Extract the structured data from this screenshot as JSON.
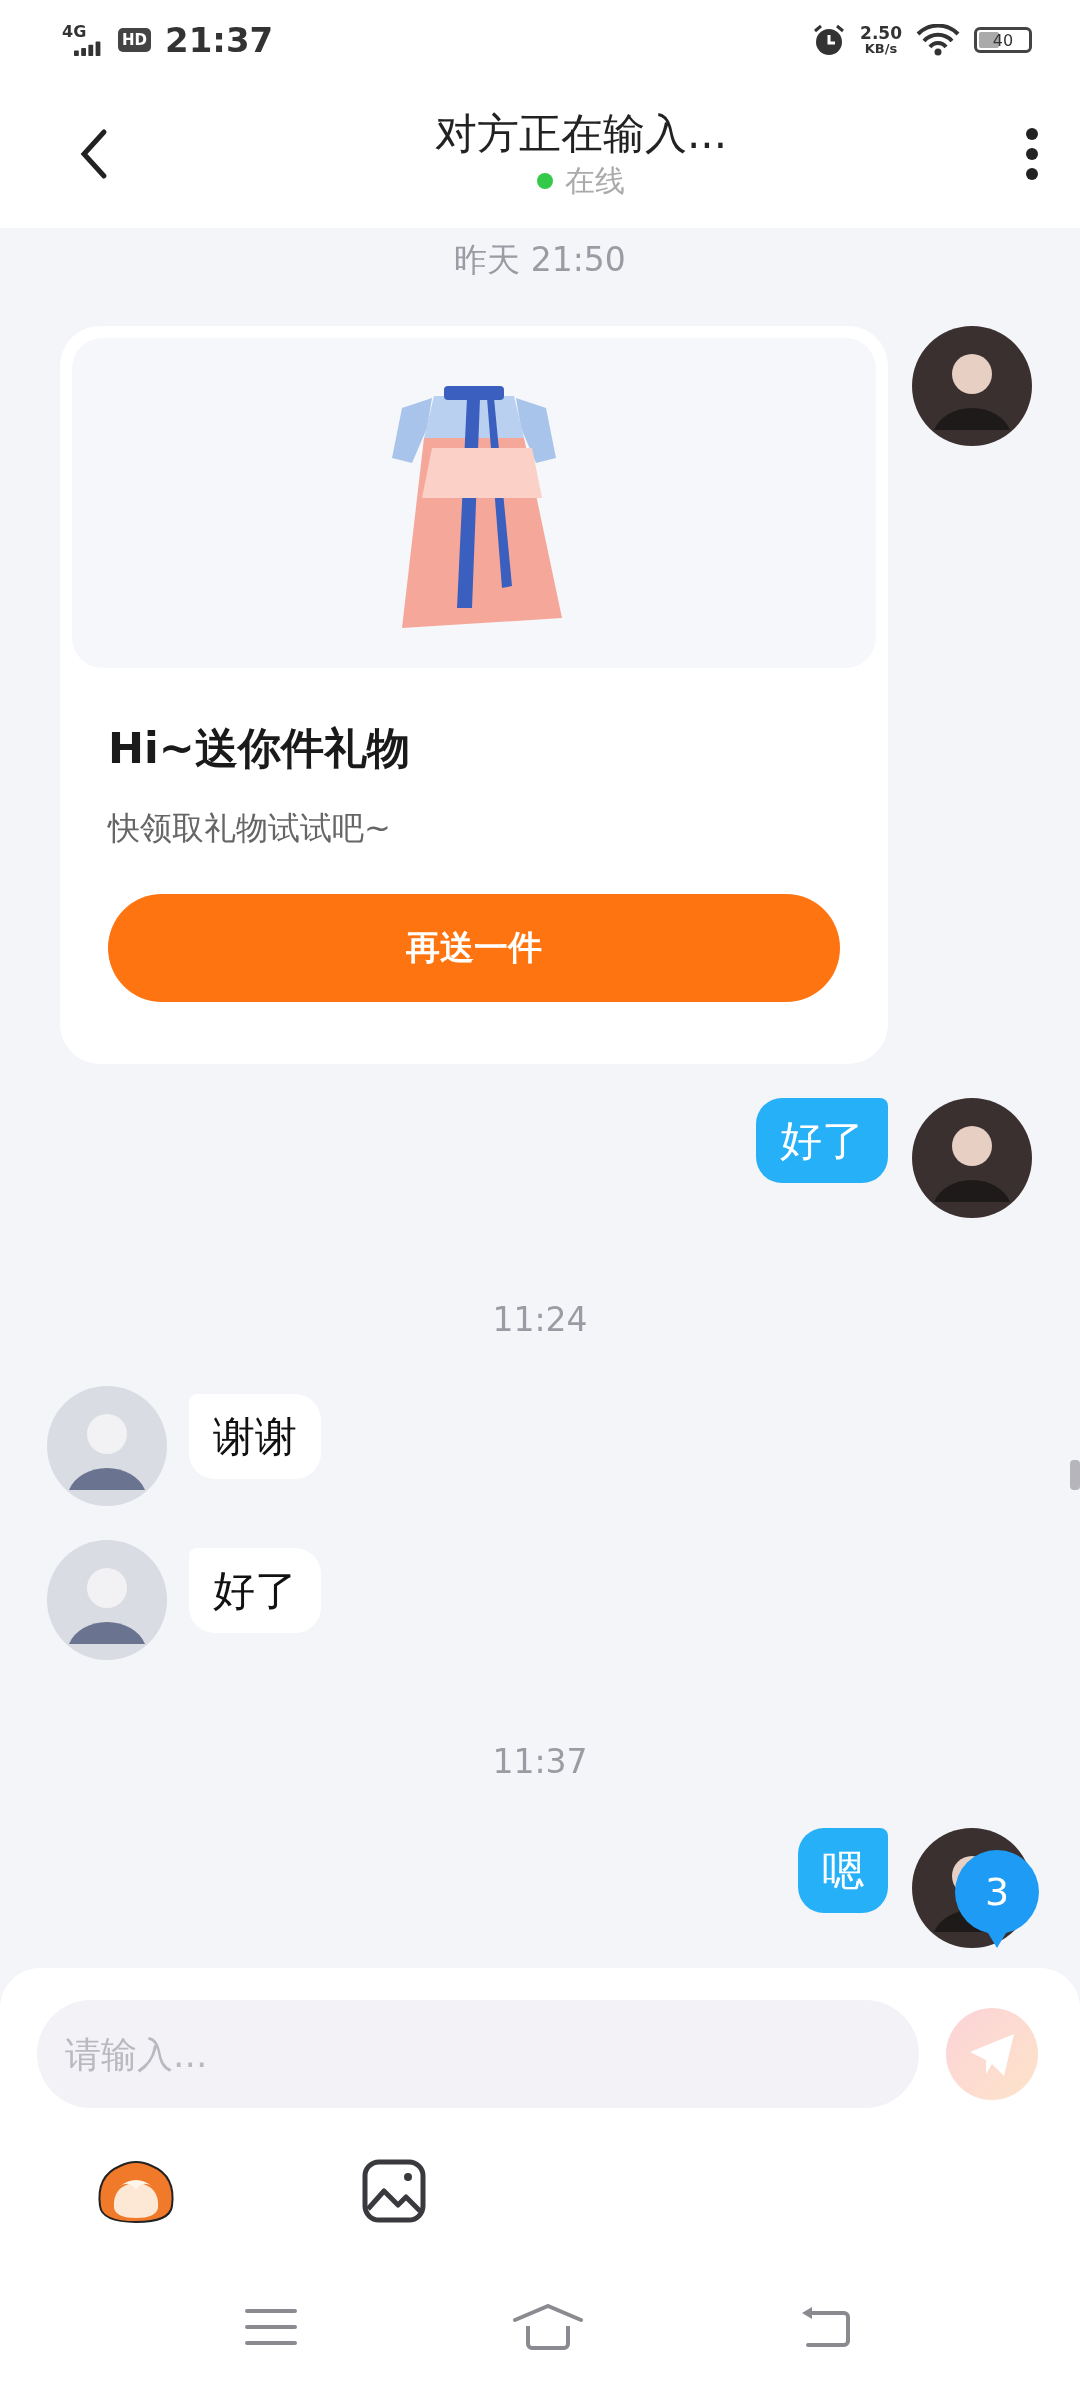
{
  "status_bar": {
    "network": "4G",
    "hd": "HD",
    "time": "21:37",
    "speed": "2.50",
    "speed_unit": "KB/s",
    "battery": "40"
  },
  "header": {
    "title": "对方正在输入...",
    "status": "在线"
  },
  "messages": [
    {
      "kind": "time",
      "text": "昨天 21:50"
    },
    {
      "kind": "gift",
      "outgoing": true,
      "title": "Hi~送你件礼物",
      "subtitle": "快领取礼物试试吧~",
      "button": "再送一件"
    },
    {
      "kind": "text",
      "outgoing": true,
      "text": "好了"
    },
    {
      "kind": "time",
      "text": "11:24"
    },
    {
      "kind": "text",
      "outgoing": false,
      "text": "谢谢"
    },
    {
      "kind": "text",
      "outgoing": false,
      "text": "好了"
    },
    {
      "kind": "time",
      "text": "11:37"
    },
    {
      "kind": "text",
      "outgoing": true,
      "text": "嗯"
    }
  ],
  "unread_badge": "3",
  "composer": {
    "placeholder": "请输入..."
  }
}
